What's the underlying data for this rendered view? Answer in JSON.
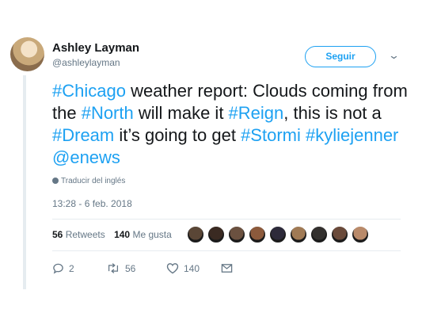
{
  "tweet": {
    "author_name": "Ashley Layman",
    "author_handle": "@ashleylayman",
    "follow_label": "Seguir",
    "text_segments": [
      {
        "t": "#Chicago",
        "tag": true
      },
      {
        "t": " weather report: Clouds coming from the ",
        "tag": false
      },
      {
        "t": "#North",
        "tag": true
      },
      {
        "t": " will make it ",
        "tag": false
      },
      {
        "t": "#Reign",
        "tag": true
      },
      {
        "t": ", this is not a ",
        "tag": false
      },
      {
        "t": "#Dream",
        "tag": true
      },
      {
        "t": " it’s going to get ",
        "tag": false
      },
      {
        "t": "#Stormi",
        "tag": true
      },
      {
        "t": " ",
        "tag": false
      },
      {
        "t": "#kyliejenner",
        "tag": true
      },
      {
        "t": " ",
        "tag": false
      },
      {
        "t": "@enews",
        "tag": true
      }
    ],
    "translate_label": "Traducir del inglés",
    "timestamp": "13:28 - 6 feb. 2018",
    "stats": {
      "retweets_count": "56",
      "retweets_label": "Retweets",
      "likes_count": "140",
      "likes_label": "Me gusta"
    },
    "liker_avatar_colors": [
      "#5a4636",
      "#3a2a22",
      "#6b5140",
      "#8c5a3c",
      "#2d2a3a",
      "#a07a55",
      "#33302e",
      "#6a4a3a",
      "#b98a6a"
    ],
    "actions": {
      "reply_count": "2",
      "retweet_count": "56",
      "like_count": "140"
    },
    "colors": {
      "accent": "#1da1f2",
      "muted": "#657786",
      "text": "#14171a"
    }
  }
}
